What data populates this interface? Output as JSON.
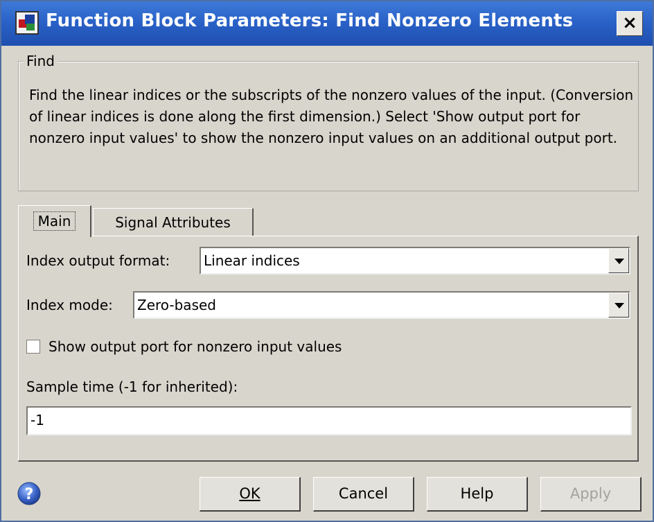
{
  "window": {
    "title": "Function Block Parameters: Find Nonzero Elements",
    "close_label": "×",
    "app_icon": "simulink-block-icon"
  },
  "description": {
    "group_label": "Find",
    "text": "Find the linear indices or the subscripts of the nonzero values of the input. (Conversion of linear indices is done along the first dimension.) Select 'Show output port for nonzero input values' to show the nonzero input values on an additional output port."
  },
  "tabs": [
    {
      "label": "Main",
      "selected": true
    },
    {
      "label": "Signal Attributes",
      "selected": false
    }
  ],
  "main": {
    "index_output_format": {
      "label": "Index output format:",
      "value": "Linear indices"
    },
    "index_mode": {
      "label": "Index mode:",
      "value": "Zero-based"
    },
    "show_output_port": {
      "label": "Show output port for nonzero input values",
      "checked": false
    },
    "sample_time": {
      "label": "Sample time (-1 for inherited):",
      "value": "-1"
    }
  },
  "buttons": {
    "ok": "OK",
    "cancel": "Cancel",
    "help": "Help",
    "apply": "Apply",
    "apply_enabled": false
  },
  "icons": {
    "help": "help-question-icon",
    "dropdown": "chevron-down-icon"
  },
  "colors": {
    "titlebar": "#2a62c8",
    "dialog_bg": "#d8d5cc",
    "help_icon": "#3a63c8"
  }
}
